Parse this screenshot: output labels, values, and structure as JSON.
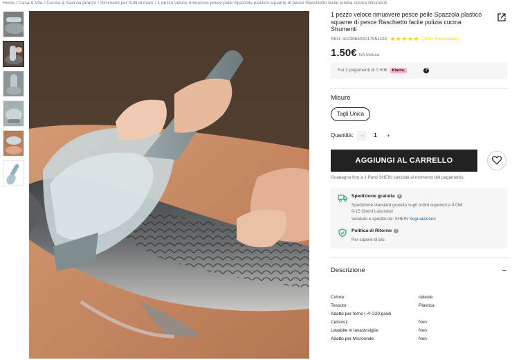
{
  "breadcrumb": {
    "items": [
      "Home",
      "Casa & Vita",
      "Cucina & Sala da pranzo",
      "Strumenti per frutti di mare",
      "1 pezzo veloce rimuovere pesce pelle Spazzola plastico squame di pesce Raschietto facile pulizia cucina Strumenti"
    ],
    "separator": "/"
  },
  "product": {
    "title": "1 pezzo veloce rimuovere pesce pelle Spazzola plastico squame di pesce Raschietto facile pulizia cucina Strumenti",
    "sku_label": "SKU: sh2306304017851102",
    "stars": "★★★★★",
    "reviews": "(100+ Recensioni)",
    "price": "1.50€",
    "vat": "IVA inclusa",
    "klarna_text": "Fai 3 pagamenti di 0.50€",
    "klarna_badge": "Klarna.",
    "help": "?"
  },
  "options": {
    "size_label": "Misure",
    "size_value": "Tagli Unica",
    "qty_label": "Quantità:",
    "qty_minus": "−",
    "qty_value": "1",
    "qty_plus": "+"
  },
  "cart": {
    "add_label": "AGGIUNGI AL CARRELLO",
    "points_text": "Guadagna fino a 1 Punti SHEIN calcolati al momento del pagamento."
  },
  "shipping": {
    "title": "Spedizione gratuita",
    "line1": "Spedizione standard gratuita sugli ordini superiori a 9.00€",
    "line2": "9-15 Giorni Lavorativi",
    "seller_prefix": "Venduto e spedito da: SHEIN",
    "seller_link": "Segnalazione",
    "return_title": "Politica di Ritorno",
    "return_text": "Per sapere di più",
    "info": "?"
  },
  "description": {
    "title": "Descrizione",
    "toggle": "−",
    "attributes": [
      {
        "key": "Colore:",
        "value": "celeste"
      },
      {
        "key": "Tessuto:",
        "value": "Plastica"
      },
      {
        "key": "Adatto per forno (-4~220 gradi",
        "value": ""
      },
      {
        "key": "Celsius):",
        "value": "Non"
      },
      {
        "key": "Lavabile in lavastoviglie:",
        "value": "Non"
      },
      {
        "key": "Adatto per Microonde:",
        "value": "Non"
      }
    ]
  },
  "colors": {
    "accent_black": "#222222",
    "star_yellow": "#facf19",
    "klarna_pink": "#ffb3c7",
    "link_blue": "#2d68a8",
    "ship_green": "#2aa06a"
  }
}
